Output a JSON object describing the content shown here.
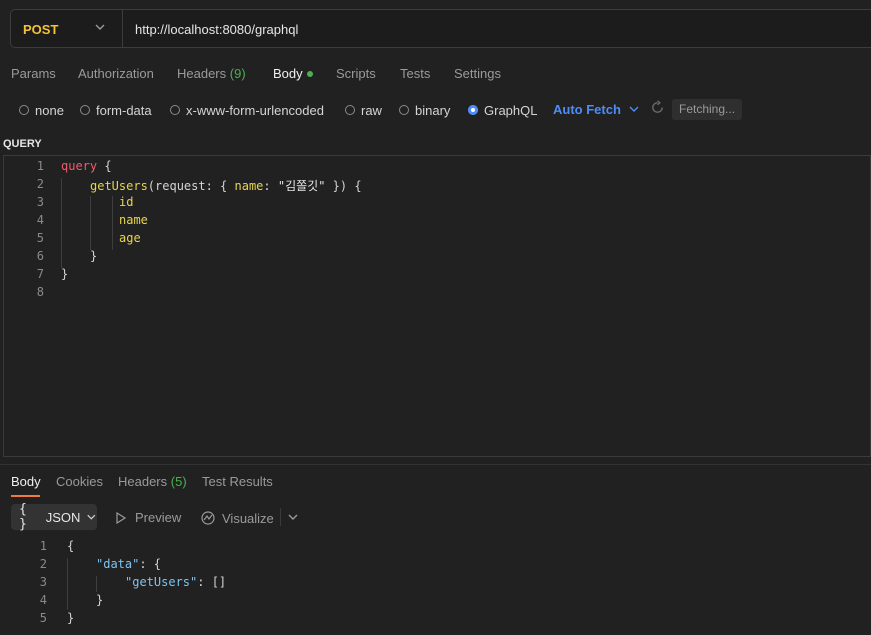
{
  "request": {
    "method": "POST",
    "url": "http://localhost:8080/graphql"
  },
  "tabs": [
    {
      "label": "Params"
    },
    {
      "label": "Authorization"
    },
    {
      "label": "Headers",
      "count": "(9)"
    },
    {
      "label": "Body",
      "active": true
    },
    {
      "label": "Scripts"
    },
    {
      "label": "Tests"
    },
    {
      "label": "Settings"
    }
  ],
  "body_types": [
    {
      "label": "none",
      "selected": false
    },
    {
      "label": "form-data",
      "selected": false
    },
    {
      "label": "x-www-form-urlencoded",
      "selected": false
    },
    {
      "label": "raw",
      "selected": false
    },
    {
      "label": "binary",
      "selected": false
    },
    {
      "label": "GraphQL",
      "selected": true
    }
  ],
  "auto_fetch_label": "Auto Fetch",
  "fetching_label": "Fetching...",
  "query_label": "QUERY",
  "query_editor": {
    "line_numbers": [
      "1",
      "2",
      "3",
      "4",
      "5",
      "6",
      "7",
      "8"
    ],
    "tokens": {
      "query_kw": "query",
      "open_brace": "{",
      "get_users": "getUsers",
      "args_open": "(request: { ",
      "name_field": "name",
      "colon": ": ",
      "name_value": "\"김쫄깃\"",
      "args_close": " }) {",
      "field_id": "id",
      "field_name": "name",
      "field_age": "age",
      "close_inner": "}",
      "close_outer": "}"
    }
  },
  "response_tabs": [
    {
      "label": "Body",
      "active": true
    },
    {
      "label": "Cookies"
    },
    {
      "label": "Headers",
      "count": "(5)"
    },
    {
      "label": "Test Results"
    }
  ],
  "response_toolbar": {
    "format_braces": "{ }",
    "format_label": "JSON",
    "preview_label": "Preview",
    "visualize_label": "Visualize"
  },
  "response_json": {
    "line_numbers": [
      "1",
      "2",
      "3",
      "4",
      "5"
    ],
    "open": "{",
    "data_key": "\"data\"",
    "data_open": ": {",
    "users_key": "\"getUsers\"",
    "users_value": ": []",
    "inner_close": "}",
    "outer_close": "}"
  },
  "colors": {
    "method": "#f4c430",
    "accent_blue": "#4d8df7",
    "count_green": "#4caf50",
    "active_underline": "#f07b3f"
  }
}
